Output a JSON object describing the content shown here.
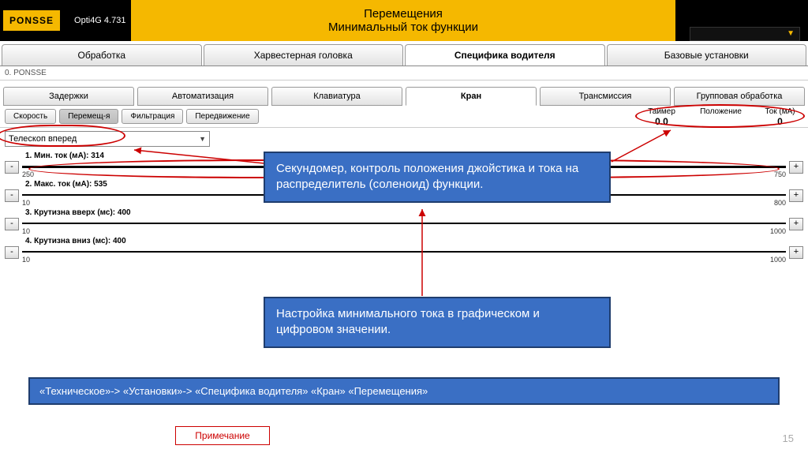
{
  "header": {
    "logo": "PONSSE",
    "version": "Opti4G 4.731",
    "title_line1": "Перемещения",
    "title_line2": "Минимальный ток функции"
  },
  "main_tabs": [
    "Обработка",
    "Харвестерная головка",
    "Специфика водителя",
    "Базовые установки"
  ],
  "main_tab_active": 2,
  "breadcrumb": "0. PONSSE",
  "sub_tabs": [
    "Задержки",
    "Автоматизация",
    "Клавиатура",
    "Кран",
    "Трансмиссия",
    "Групповая обработка"
  ],
  "sub_tab_active": 3,
  "toolbar": {
    "buttons": [
      "Скорость",
      "Перемещ-я",
      "Фильтрация",
      "Передвижение"
    ],
    "selected": 1
  },
  "readouts": {
    "timer_label": "Таймер",
    "timer_value": "0.0",
    "pos_label": "Положение",
    "pos_value": "",
    "cur_label": "Ток (мА)",
    "cur_value": "0"
  },
  "dropdown": {
    "value": "Телескоп вперед"
  },
  "params": [
    {
      "label": "1. Мин. ток  (мА): 314",
      "min": "250",
      "max": "750"
    },
    {
      "label": "2. Макс. ток  (мА): 535",
      "min": "10",
      "max": "800"
    },
    {
      "label": "3. Крутизна вверх (мс): 400",
      "min": "10",
      "max": "1000"
    },
    {
      "label": "4. Крутизна вниз (мс): 400",
      "min": "10",
      "max": "1000"
    }
  ],
  "callouts": {
    "c1": "Секундомер, контроль положения джойстика и тока на распределитель (соленоид) функции.",
    "c2": " Настройка минимального тока в графическом и цифровом значении."
  },
  "path": "«Техническое»-> «Установки»-> «Специфика водителя» «Кран» «Перемещения»",
  "note": "Примечание",
  "page": "15"
}
